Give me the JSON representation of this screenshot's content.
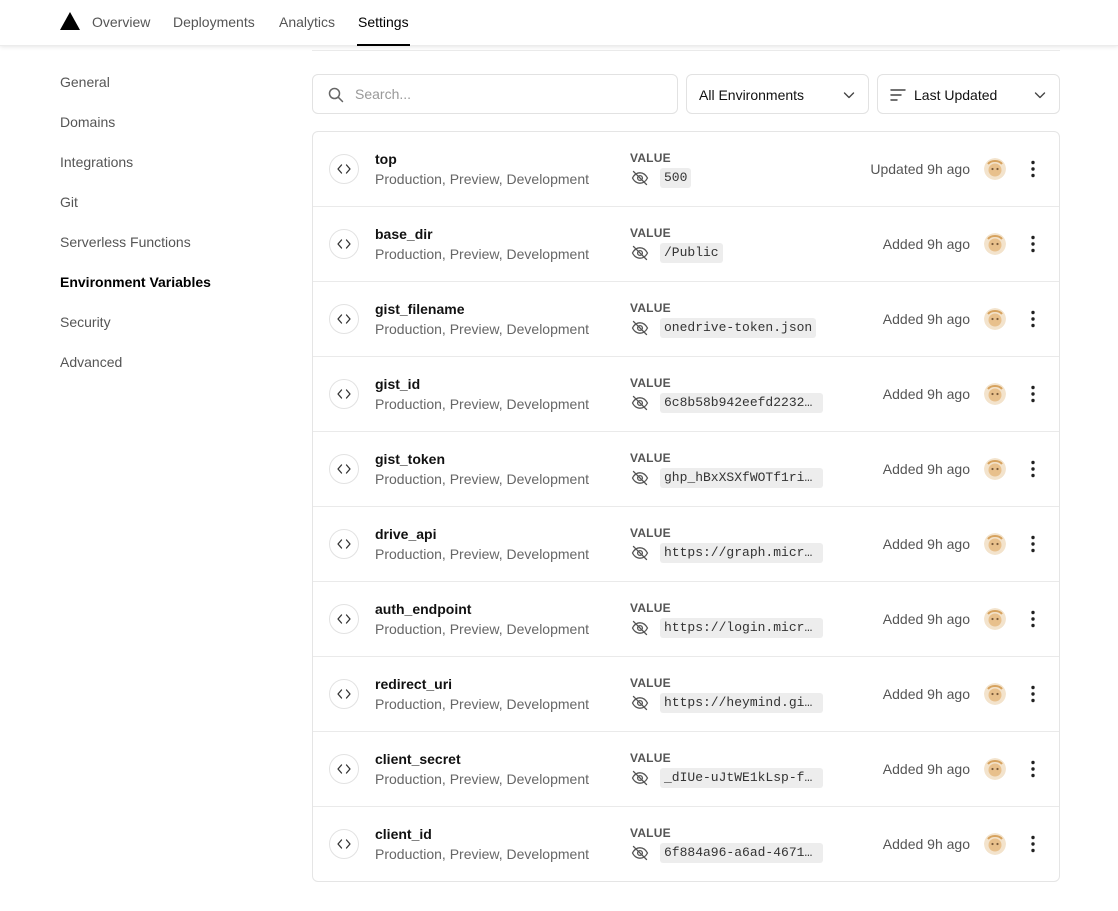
{
  "nav": {
    "tabs": [
      {
        "label": "Overview"
      },
      {
        "label": "Deployments"
      },
      {
        "label": "Analytics"
      },
      {
        "label": "Settings",
        "active": true
      }
    ]
  },
  "sidebar": {
    "items": [
      {
        "label": "General"
      },
      {
        "label": "Domains"
      },
      {
        "label": "Integrations"
      },
      {
        "label": "Git"
      },
      {
        "label": "Serverless Functions"
      },
      {
        "label": "Environment Variables",
        "active": true
      },
      {
        "label": "Security"
      },
      {
        "label": "Advanced"
      }
    ]
  },
  "toolbar": {
    "search_placeholder": "Search...",
    "environment_filter": "All Environments",
    "sort": "Last Updated"
  },
  "value_label": "VALUE",
  "variables": [
    {
      "name": "top",
      "environments": "Production, Preview, Development",
      "value": "500",
      "status": "Updated 9h ago"
    },
    {
      "name": "base_dir",
      "environments": "Production, Preview, Development",
      "value": "/Public",
      "status": "Added 9h ago"
    },
    {
      "name": "gist_filename",
      "environments": "Production, Preview, Development",
      "value": "onedrive-token.json",
      "status": "Added 9h ago"
    },
    {
      "name": "gist_id",
      "environments": "Production, Preview, Development",
      "value": "6c8b58b942eefd2232...",
      "status": "Added 9h ago"
    },
    {
      "name": "gist_token",
      "environments": "Production, Preview, Development",
      "value": "ghp_hBxXSXfWOTf1ri...",
      "status": "Added 9h ago"
    },
    {
      "name": "drive_api",
      "environments": "Production, Preview, Development",
      "value": "https://graph.micr...",
      "status": "Added 9h ago"
    },
    {
      "name": "auth_endpoint",
      "environments": "Production, Preview, Development",
      "value": "https://login.micr...",
      "status": "Added 9h ago"
    },
    {
      "name": "redirect_uri",
      "environments": "Production, Preview, Development",
      "value": "https://heymind.gi...",
      "status": "Added 9h ago"
    },
    {
      "name": "client_secret",
      "environments": "Production, Preview, Development",
      "value": "_dIUe-uJtWE1kLsp-f...",
      "status": "Added 9h ago"
    },
    {
      "name": "client_id",
      "environments": "Production, Preview, Development",
      "value": "6f884a96-a6ad-4671...",
      "status": "Added 9h ago"
    }
  ],
  "colors": {
    "accent": "#000000",
    "muted_text": "#666666",
    "border": "#e5e5e5",
    "value_bg": "#ededed"
  },
  "icons": [
    "logo-triangle-icon",
    "search-icon",
    "chevron-down-icon",
    "sort-lines-icon",
    "code-brackets-icon",
    "eye-off-icon",
    "avatar",
    "more-vertical-icon"
  ]
}
